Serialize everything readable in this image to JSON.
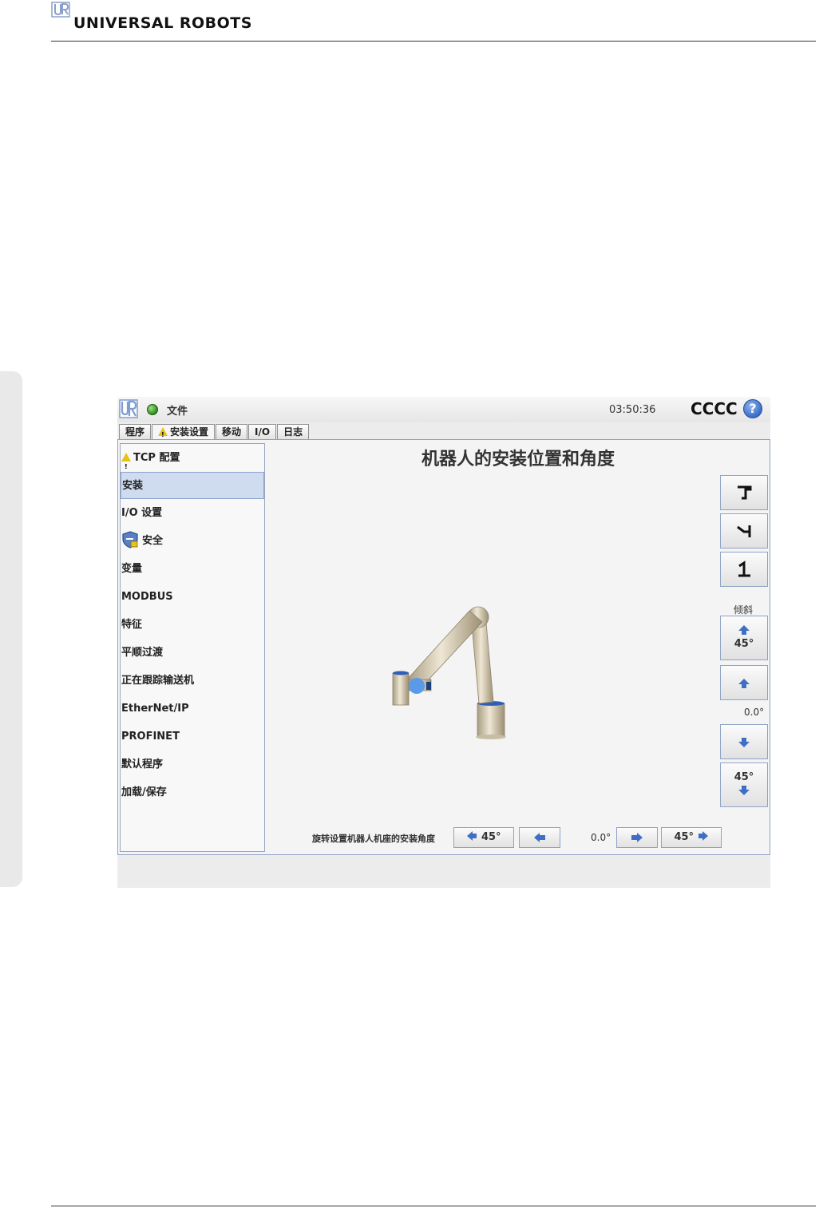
{
  "document": {
    "brand": "UNIVERSAL ROBOTS"
  },
  "topbar": {
    "file_menu": "文件",
    "clock": "03:50:36",
    "robot_name": "CCCC",
    "help_label": "?"
  },
  "tabs": [
    {
      "label": "程序",
      "active": false
    },
    {
      "label": "安装设置",
      "active": true,
      "warning": true
    },
    {
      "label": "移动",
      "active": false
    },
    {
      "label": "I/O",
      "active": false
    },
    {
      "label": "日志",
      "active": false
    }
  ],
  "sidebar": {
    "items": [
      {
        "label": "TCP 配置",
        "warning": true
      },
      {
        "label": "安装",
        "selected": true
      },
      {
        "label": "I/O 设置"
      },
      {
        "label": "安全",
        "icon": "shield-icon"
      },
      {
        "label": "变量"
      },
      {
        "label": "MODBUS"
      },
      {
        "label": "特征"
      },
      {
        "label": "平顺过渡"
      },
      {
        "label": "正在跟踪输送机"
      },
      {
        "label": "EtherNet/IP"
      },
      {
        "label": "PROFINET"
      },
      {
        "label": "默认程序"
      },
      {
        "label": "加载/保存"
      }
    ]
  },
  "main": {
    "title": "机器人的安装位置和角度",
    "tilt_label": "倾斜",
    "tilt_value": "0.0°",
    "tilt_up_big": "45°",
    "tilt_down_big": "45°",
    "rotate_label": "旋转设置机器人机座的安装角度",
    "rotate_value": "0.0°",
    "rotate_left_big": "45°",
    "rotate_right_big": "45°"
  },
  "colors": {
    "accent": "#3a6dc9",
    "status_ok": "#2f8a1f",
    "warning": "#e7c21a",
    "selection": "#cfdcef",
    "arrow": "#3f6fc4"
  }
}
